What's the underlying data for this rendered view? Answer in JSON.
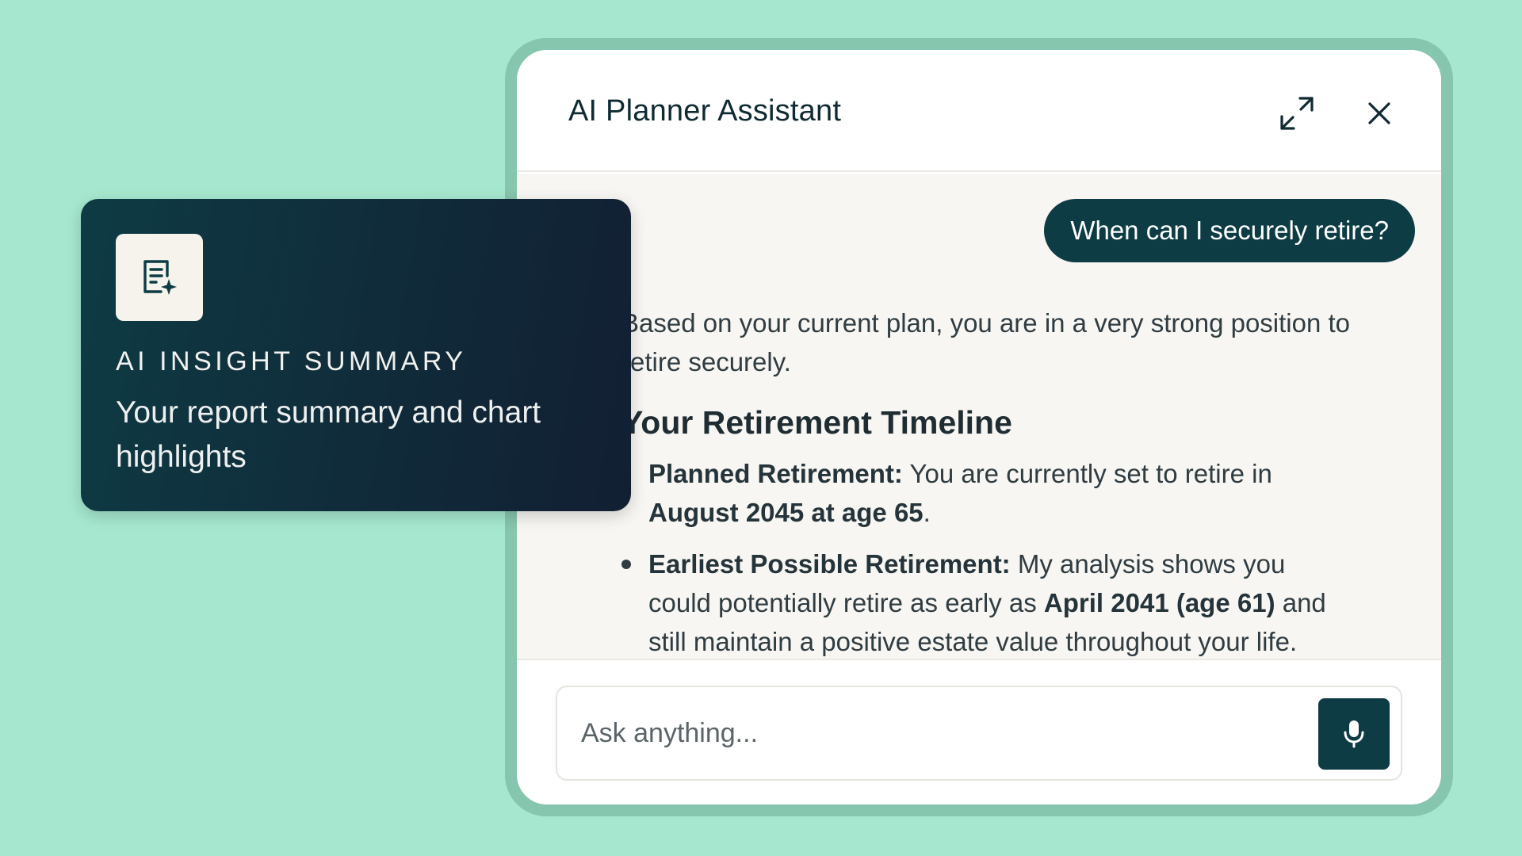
{
  "chat": {
    "title": "AI Planner Assistant",
    "user_message": "When can I securely retire?",
    "reply": {
      "intro": "Based on your current plan, you are in a very strong position to retire securely.",
      "heading": "Your Retirement Timeline",
      "bullets": [
        {
          "label": "Planned Retirement:",
          "text_before": " You are currently set to retire in ",
          "emphasis": "August 2045 at age 65",
          "text_after": "."
        },
        {
          "label": "Earliest Possible Retirement:",
          "text_before": " My analysis shows you could potentially retire as early as ",
          "emphasis": "April 2041 (age 61)",
          "text_after": " and still maintain a positive estate value throughout your life."
        }
      ]
    },
    "input": {
      "placeholder": "Ask anything..."
    }
  },
  "insight_card": {
    "kicker": "AI INSIGHT SUMMARY",
    "description": "Your report summary and chart highlights"
  },
  "icons": {
    "expand": "expand-icon",
    "close": "close-icon",
    "mic": "microphone-icon",
    "report": "report-sparkle-icon"
  },
  "colors": {
    "background": "#a6e8cf",
    "frame": "#86c5ae",
    "accent_dark": "#0d3c44",
    "chat_body": "#f8f6f2"
  }
}
